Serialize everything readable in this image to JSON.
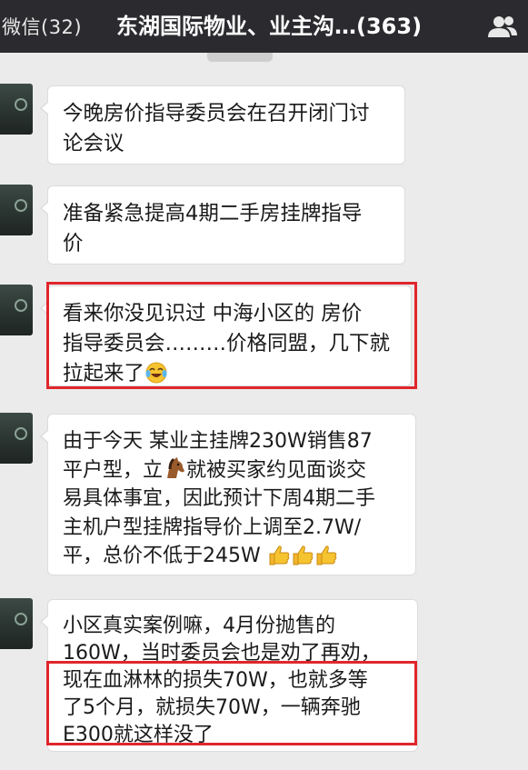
{
  "header": {
    "back_label": "微信(32)",
    "title": "东湖国际物业、业主沟…(363)",
    "group_icon": "group-members-icon"
  },
  "messages": [
    {
      "lines": [
        "今晚房价指导委员会在召开闭门讨",
        "论会议"
      ]
    },
    {
      "lines": [
        "准备紧急提高4期二手房挂牌指导",
        "价"
      ]
    },
    {
      "lines": [
        "看来你没见识过 中海小区的 房价",
        "指导委员会………价格同盟，几下就",
        "拉起来了"
      ]
    },
    {
      "lines": [
        "由于今天 某业主挂牌230W销售87",
        "平户型，立",
        "就被买家约见面谈交",
        "易具体事宜，因此预计下周4期二手",
        "主机户型挂牌指导价上调至2.7W/",
        "平，总价不低于245W"
      ]
    },
    {
      "lines": [
        "小区真实案例嘛，4月份抛售的",
        "160W，当时委员会也是劝了再劝，",
        "现在血淋林的损失70W，也就多等",
        "了5个月，就损失70W，一辆奔驰",
        "E300就这样没了"
      ]
    }
  ],
  "colors": {
    "topbar": "#2b2b2f",
    "background": "#ebebeb",
    "highlight": "#e0262b"
  }
}
